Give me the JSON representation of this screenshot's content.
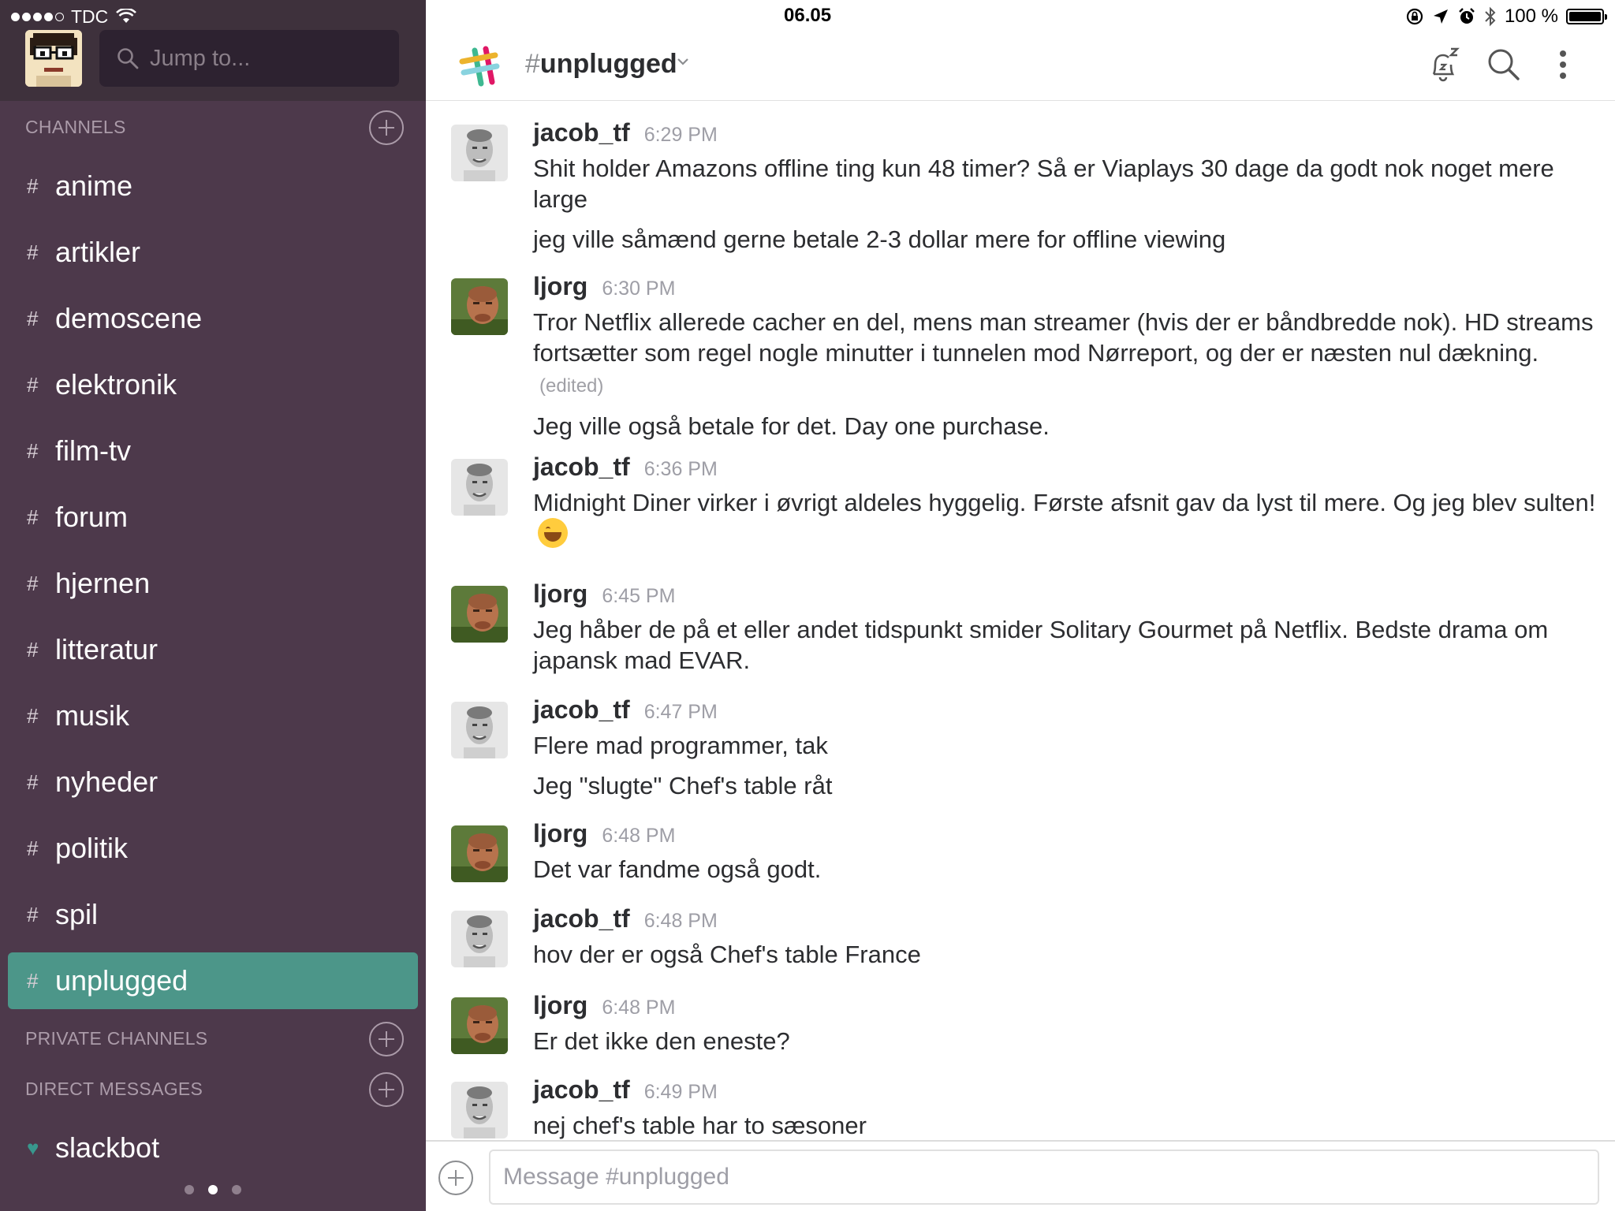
{
  "status_bar": {
    "carrier": "TDC",
    "time": "06.05",
    "battery": "100 %"
  },
  "sidebar": {
    "jump_placeholder": "Jump to...",
    "channels_header": "CHANNELS",
    "channels": [
      {
        "hash": "#",
        "name": "anime"
      },
      {
        "hash": "#",
        "name": "artikler"
      },
      {
        "hash": "#",
        "name": "demoscene"
      },
      {
        "hash": "#",
        "name": "elektronik"
      },
      {
        "hash": "#",
        "name": "film-tv"
      },
      {
        "hash": "#",
        "name": "forum"
      },
      {
        "hash": "#",
        "name": "hjernen"
      },
      {
        "hash": "#",
        "name": "litteratur"
      },
      {
        "hash": "#",
        "name": "musik"
      },
      {
        "hash": "#",
        "name": "nyheder"
      },
      {
        "hash": "#",
        "name": "politik"
      },
      {
        "hash": "#",
        "name": "spil"
      },
      {
        "hash": "#",
        "name": "unplugged"
      }
    ],
    "active_channel": "unplugged",
    "private_channels_header": "PRIVATE CHANNELS",
    "direct_messages_header": "DIRECT MESSAGES",
    "direct_messages": [
      {
        "icon": "heart-icon",
        "name": "slackbot"
      }
    ],
    "colors": {
      "background": "#4d394b",
      "active": "#4c9689"
    }
  },
  "header": {
    "hash": "#",
    "channel_name": "unplugged"
  },
  "messages": [
    {
      "author": "jacob_tf",
      "time": "6:29 PM",
      "lines": [
        "Shit holder Amazons offline ting kun 48 timer? Så er Viaplays 30 dage da godt nok noget mere large",
        "jeg ville såmænd gerne betale 2-3 dollar mere for offline viewing"
      ]
    },
    {
      "author": "ljorg",
      "time": "6:30 PM",
      "lines": [
        "Tror  Netflix allerede cacher en del, mens man streamer (hvis der er båndbredde nok). HD streams fortsætter som regel nogle minutter i tunnelen mod Nørreport, og der er næsten nul dækning.",
        "Jeg ville også betale for det. Day one purchase."
      ],
      "edited_label": "(edited)"
    },
    {
      "author": "jacob_tf",
      "time": "6:36 PM",
      "lines": [
        "Midnight Diner virker i øvrigt aldeles hyggelig. Første afsnit gav da lyst til mere. Og jeg blev sulten!"
      ],
      "emoji": "grinning-emoji"
    },
    {
      "author": "ljorg",
      "time": "6:45 PM",
      "lines": [
        "Jeg håber de på et eller andet tidspunkt smider Solitary Gourmet på Netflix. Bedste drama om japansk mad EVAR."
      ]
    },
    {
      "author": "jacob_tf",
      "time": "6:47 PM",
      "lines": [
        "Flere mad programmer, tak",
        "Jeg \"slugte\" Chef's table råt"
      ]
    },
    {
      "author": "ljorg",
      "time": "6:48 PM",
      "lines": [
        "Det var fandme også godt."
      ]
    },
    {
      "author": "jacob_tf",
      "time": "6:48 PM",
      "lines": [
        "hov der er også Chef's table France"
      ]
    },
    {
      "author": "ljorg",
      "time": "6:48 PM",
      "lines": [
        "Er det ikke den eneste?"
      ]
    },
    {
      "author": "jacob_tf",
      "time": "6:49 PM",
      "lines": [
        "nej chef's table har to sæsoner"
      ]
    }
  ],
  "composer": {
    "placeholder": "Message #unplugged"
  }
}
